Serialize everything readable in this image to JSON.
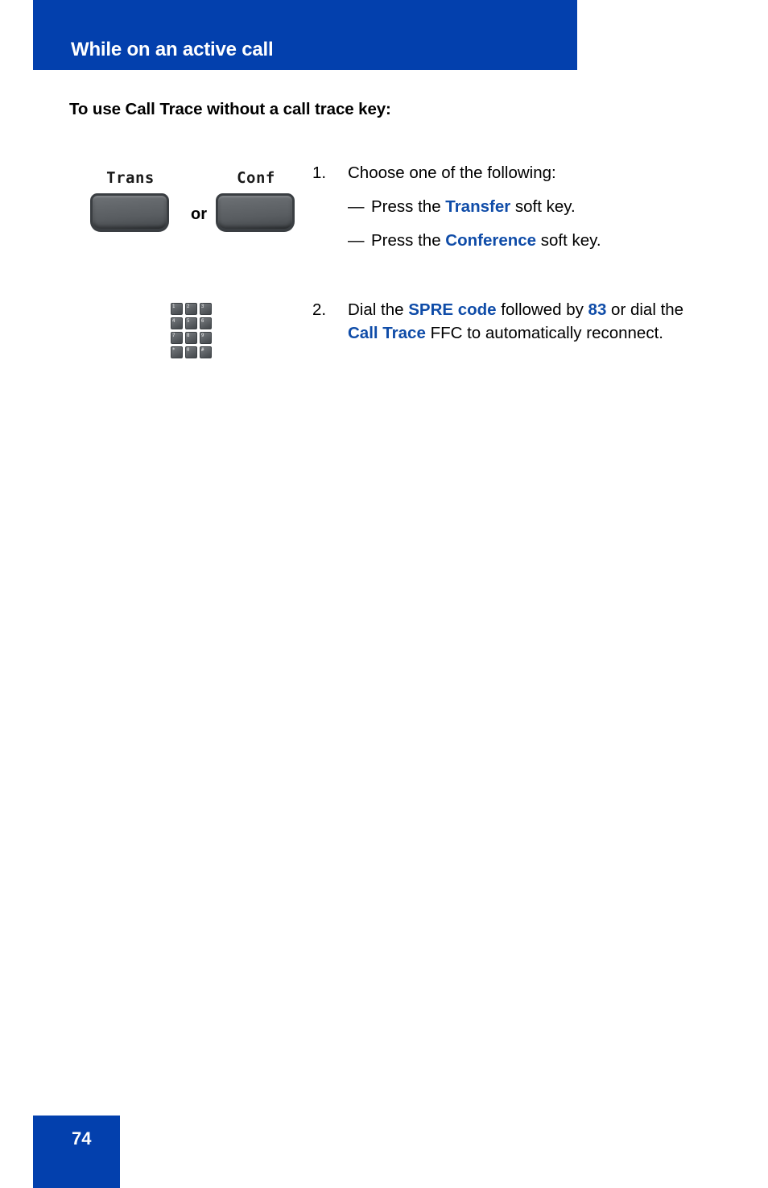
{
  "header": {
    "title": "While on an active call",
    "bar_color": "#0340ad"
  },
  "section": {
    "heading": "To use Call Trace without a call trace key:"
  },
  "accent_color": "#0f4ca8",
  "steps": [
    {
      "number": "1.",
      "text": "Choose one of the following:",
      "sub_items": [
        {
          "dash": "—",
          "prefix": "Press the ",
          "term": "Transfer",
          "suffix": " soft key."
        },
        {
          "dash": "—",
          "prefix": "Press the ",
          "term": "Conference",
          "suffix": " soft key."
        }
      ]
    },
    {
      "number": "2.",
      "parts": {
        "p1": "Dial the ",
        "t1": "SPRE code",
        "p2": " followed by ",
        "t2": "83",
        "p3": " or dial the ",
        "t3": "Call Trace",
        "p4": " FFC to automatically reconnect."
      }
    }
  ],
  "softkeys": {
    "trans_label": "Trans",
    "conf_label": "Conf",
    "or_label": "or"
  },
  "keypad": {
    "keys": [
      {
        "digit": "1",
        "letters": ""
      },
      {
        "digit": "2",
        "letters": "ABC"
      },
      {
        "digit": "3",
        "letters": "DEF"
      },
      {
        "digit": "4",
        "letters": "GHI"
      },
      {
        "digit": "5",
        "letters": "JKL"
      },
      {
        "digit": "6",
        "letters": "MNO"
      },
      {
        "digit": "7",
        "letters": "PQRS"
      },
      {
        "digit": "8",
        "letters": "TUV"
      },
      {
        "digit": "9",
        "letters": "WXYZ"
      },
      {
        "digit": "*",
        "letters": ""
      },
      {
        "digit": "0",
        "letters": ""
      },
      {
        "digit": "#",
        "letters": ""
      }
    ]
  },
  "footer": {
    "page_number": "74"
  }
}
